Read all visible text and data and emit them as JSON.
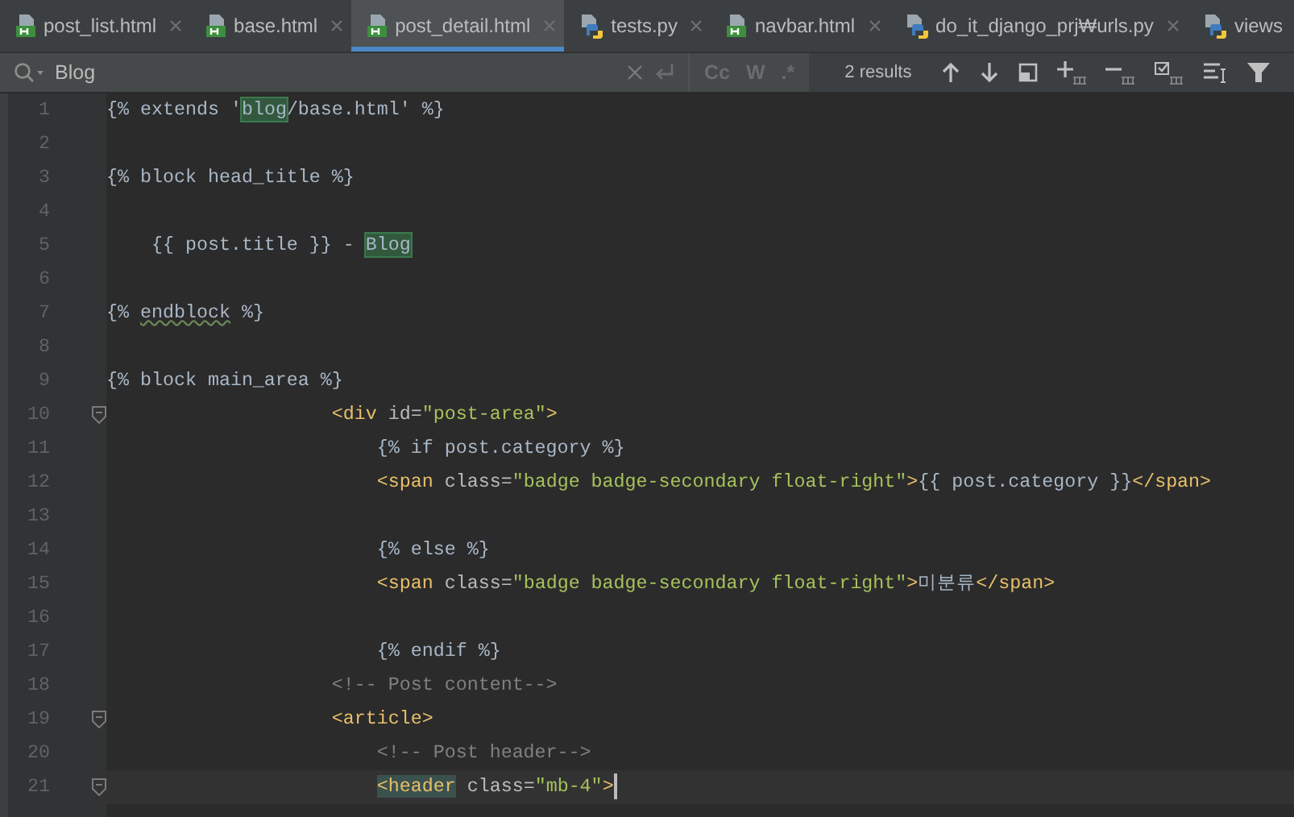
{
  "tabs": [
    {
      "label": "post_list.html",
      "kind": "html",
      "selected": false
    },
    {
      "label": "base.html",
      "kind": "html",
      "selected": false
    },
    {
      "label": "post_detail.html",
      "kind": "html",
      "selected": true
    },
    {
      "label": "tests.py",
      "kind": "python",
      "selected": false
    },
    {
      "label": "navbar.html",
      "kind": "html",
      "selected": false
    },
    {
      "label": "do_it_django_prj₩urls.py",
      "kind": "python",
      "selected": false
    },
    {
      "label": "views",
      "kind": "python",
      "selected": false
    }
  ],
  "search": {
    "value": "Blog",
    "toggles": [
      {
        "label": "Cc"
      },
      {
        "label": "W"
      },
      {
        "label": ".*"
      }
    ],
    "results": "2 results"
  },
  "lines": [
    {
      "number": "1",
      "tokens": [
        {
          "kind": "tpl",
          "text": "{% extends '"
        },
        {
          "kind": "tpl",
          "text": "blog",
          "match": true
        },
        {
          "kind": "tpl",
          "text": "/base.html' %}"
        }
      ]
    },
    {
      "number": "2"
    },
    {
      "number": "3",
      "tokens": [
        {
          "kind": "tpl",
          "text": "{% block head_title %}"
        }
      ]
    },
    {
      "number": "4"
    },
    {
      "number": "5",
      "tokens": [
        {
          "kind": "tpl",
          "text": "    {{ post.title }} - "
        },
        {
          "kind": "tpl",
          "text": "Blog",
          "match": true
        }
      ]
    },
    {
      "number": "6"
    },
    {
      "number": "7",
      "tokens": [
        {
          "kind": "tpl",
          "text": "{% "
        },
        {
          "kind": "tpl",
          "text": "endblock",
          "squiggle": true
        },
        {
          "kind": "tpl",
          "text": " %}"
        }
      ]
    },
    {
      "number": "8"
    },
    {
      "number": "9",
      "tokens": [
        {
          "kind": "tpl",
          "text": "{% block main_area %}"
        }
      ]
    },
    {
      "number": "10",
      "fold": true,
      "tokens": [
        {
          "kind": "tag",
          "text": "                    <div "
        },
        {
          "kind": "attr",
          "text": "id="
        },
        {
          "kind": "str",
          "text": "\"post-area\""
        },
        {
          "kind": "tag",
          "text": ">"
        }
      ]
    },
    {
      "number": "11",
      "tokens": [
        {
          "kind": "tpl",
          "text": "                        {% if post.category %}"
        }
      ]
    },
    {
      "number": "12",
      "tokens": [
        {
          "kind": "tag",
          "text": "                        <span "
        },
        {
          "kind": "attr",
          "text": "class="
        },
        {
          "kind": "str",
          "text": "\"badge badge-secondary float-right\""
        },
        {
          "kind": "tag",
          "text": ">"
        },
        {
          "kind": "tpl",
          "text": "{{ post.category }}"
        },
        {
          "kind": "tag",
          "text": "</span>"
        }
      ]
    },
    {
      "number": "13"
    },
    {
      "number": "14",
      "tokens": [
        {
          "kind": "tpl",
          "text": "                        {% else %}"
        }
      ]
    },
    {
      "number": "15",
      "tokens": [
        {
          "kind": "tag",
          "text": "                        <span "
        },
        {
          "kind": "attr",
          "text": "class="
        },
        {
          "kind": "str",
          "text": "\"badge badge-secondary float-right\""
        },
        {
          "kind": "tag",
          "text": ">"
        },
        {
          "kind": "tpl",
          "text": "미분류"
        },
        {
          "kind": "tag",
          "text": "</span>"
        }
      ]
    },
    {
      "number": "16"
    },
    {
      "number": "17",
      "tokens": [
        {
          "kind": "tpl",
          "text": "                        {% endif %}"
        }
      ]
    },
    {
      "number": "18",
      "tokens": [
        {
          "kind": "comment",
          "text": "                    <!-- Post content-->"
        }
      ]
    },
    {
      "number": "19",
      "fold": true,
      "tokens": [
        {
          "kind": "tag",
          "text": "                    <article>"
        }
      ]
    },
    {
      "number": "20",
      "tokens": [
        {
          "kind": "comment",
          "text": "                        <!-- Post header-->"
        }
      ]
    },
    {
      "number": "21",
      "fold": true,
      "current": true,
      "tokens": [
        {
          "kind": "tag",
          "text": "                        <header",
          "brace": true
        },
        {
          "kind": "attr",
          "text": " class="
        },
        {
          "kind": "str",
          "text": "\"mb-4\""
        },
        {
          "kind": "tag",
          "text": ">"
        }
      ]
    }
  ]
}
